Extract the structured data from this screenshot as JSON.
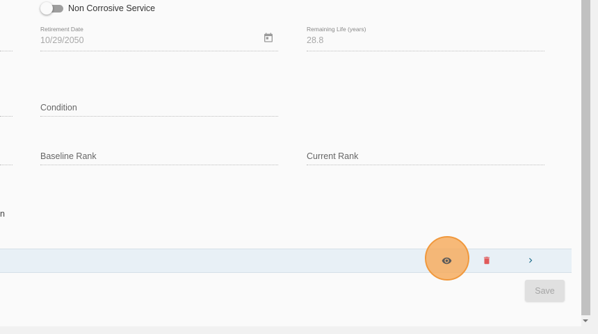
{
  "toggle": {
    "label": "Non Corrosive Service",
    "checked": false
  },
  "fields": {
    "retirement_date": {
      "label": "Retirement Date",
      "value": "10/29/2050"
    },
    "remaining_life": {
      "label": "Remaining Life (years)",
      "value": "28.8"
    },
    "condition": {
      "placeholder": "Condition"
    },
    "baseline_rank": {
      "placeholder": "Baseline Rank"
    },
    "current_rank": {
      "placeholder": "Current Rank"
    }
  },
  "cut_off_text": "n",
  "row": {
    "icons": [
      "eye-icon",
      "trash-icon",
      "chevron-right-icon"
    ]
  },
  "actions": {
    "save_label": "Save"
  },
  "colors": {
    "row_background": "#e8f0f6",
    "delete_icon": "#e05a5a",
    "chevron_icon": "#1f6e8c",
    "eye_icon": "#555555",
    "highlight": "#f6ad60"
  }
}
